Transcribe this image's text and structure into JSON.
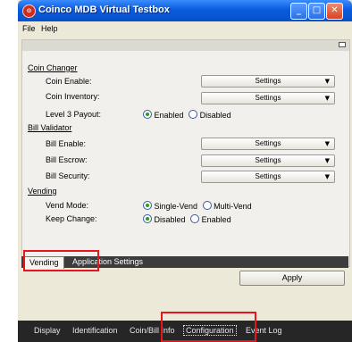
{
  "window": {
    "title": "Coinco MDB Virtual Testbox",
    "app_icon_glyph": "⊙",
    "controls": {
      "minimize": "_",
      "maximize": "□",
      "close": "✕"
    }
  },
  "menu": [
    "File",
    "Help"
  ],
  "sections": {
    "coin_changer": {
      "heading": "Coin Changer",
      "coin_enable_label": "Coin Enable:",
      "coin_enable_value": "Settings",
      "coin_inventory_label": "Coin Inventory:",
      "coin_inventory_value": "Settings",
      "level3_label": "Level 3 Payout:",
      "level3_options": [
        "Enabled",
        "Disabled"
      ],
      "level3_selected": "Enabled"
    },
    "bill_validator": {
      "heading": "Bill Validator",
      "bill_enable_label": "Bill Enable:",
      "bill_enable_value": "Settings",
      "bill_escrow_label": "Bill Escrow:",
      "bill_escrow_value": "Settings",
      "bill_security_label": "Bill Security:",
      "bill_security_value": "Settings"
    },
    "vending": {
      "heading": "Vending",
      "vend_mode_label": "Vend Mode:",
      "vend_mode_options": [
        "Single-Vend",
        "Multi-Vend"
      ],
      "vend_mode_selected": "Single-Vend",
      "keep_change_label": "Keep Change:",
      "keep_change_options": [
        "Disabled",
        "Enabled"
      ],
      "keep_change_selected": "Disabled"
    }
  },
  "inner_tabs": [
    "Vending",
    "Application Settings"
  ],
  "apply_label": "Apply",
  "bottom_tabs": [
    "Display",
    "Identification",
    "Coin/Bill Info",
    "Configuration",
    "Event Log"
  ],
  "colors": {
    "titlebar": "#0a5cdc",
    "highlight": "#e8141e",
    "bottom_bar": "#262626"
  }
}
